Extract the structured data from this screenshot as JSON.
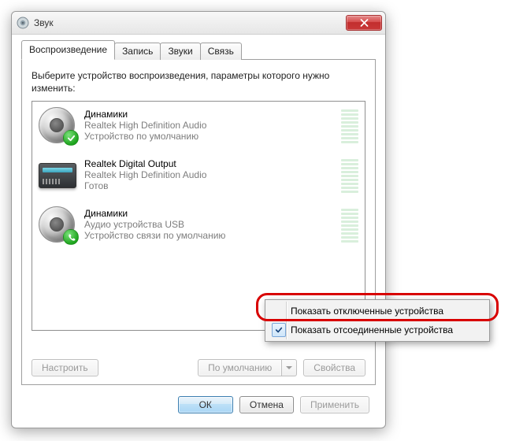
{
  "window": {
    "title": "Звук"
  },
  "tabs": {
    "playback": "Воспроизведение",
    "recording": "Запись",
    "sounds": "Звуки",
    "communications": "Связь"
  },
  "instruction": "Выберите устройство воспроизведения, параметры которого нужно изменить:",
  "devices": [
    {
      "name": "Динамики",
      "driver": "Realtek High Definition Audio",
      "status": "Устройство по умолчанию",
      "icon": "speaker",
      "badge": "check"
    },
    {
      "name": "Realtek Digital Output",
      "driver": "Realtek High Definition Audio",
      "status": "Готов",
      "icon": "interface",
      "badge": "none"
    },
    {
      "name": "Динамики",
      "driver": "Аудио устройства USB",
      "status": "Устройство связи по умолчанию",
      "icon": "speaker",
      "badge": "phone"
    }
  ],
  "panel_buttons": {
    "configure": "Настроить",
    "set_default": "По умолчанию",
    "properties": "Свойства"
  },
  "dialog_buttons": {
    "ok": "ОК",
    "cancel": "Отмена",
    "apply": "Применить"
  },
  "context_menu": {
    "show_disabled": "Показать отключенные устройства",
    "show_disconnected": "Показать отсоединенные устройства"
  }
}
